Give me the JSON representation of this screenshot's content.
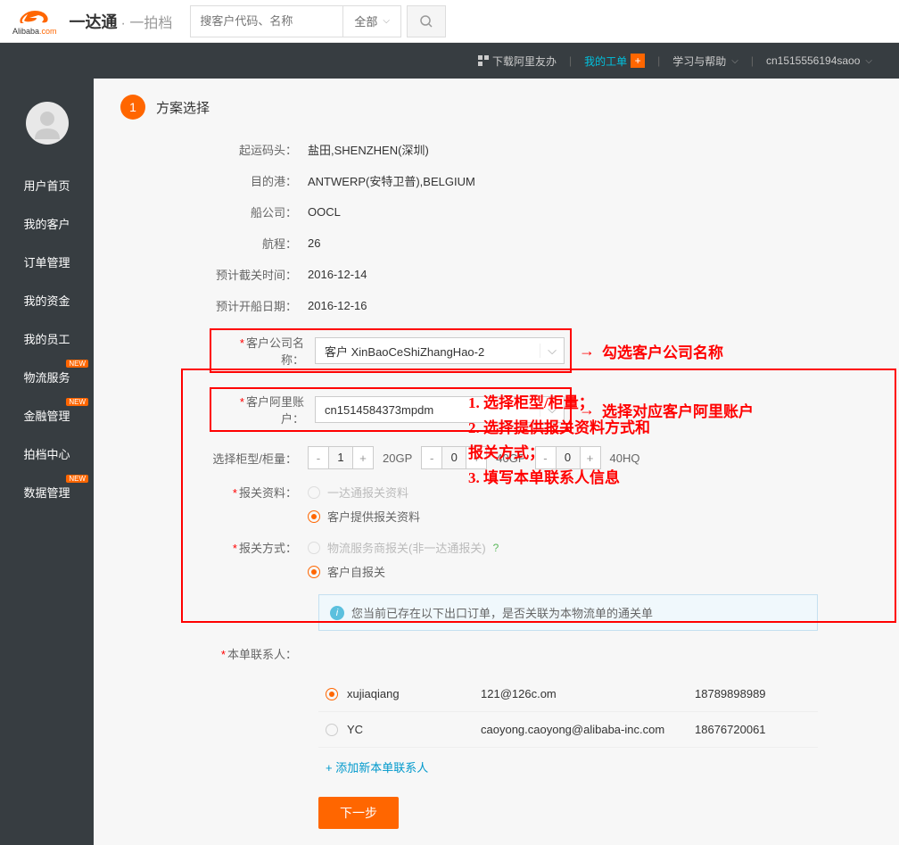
{
  "header": {
    "logo_text": "Alibaba",
    "logo_suffix": ".com",
    "brand": "一达通",
    "brand_sub": "· 一拍档",
    "search_placeholder": "搜客户代码、名称",
    "search_dropdown": "全部"
  },
  "navbar": {
    "download": "下载阿里友办",
    "workorder": "我的工单",
    "workorder_badge": "+",
    "help": "学习与帮助",
    "username": "cn1515556194saoo"
  },
  "sidebar": {
    "items": [
      {
        "label": "用户首页",
        "new": false
      },
      {
        "label": "我的客户",
        "new": false
      },
      {
        "label": "订单管理",
        "new": false
      },
      {
        "label": "我的资金",
        "new": false
      },
      {
        "label": "我的员工",
        "new": false
      },
      {
        "label": "物流服务",
        "new": true
      },
      {
        "label": "金融管理",
        "new": true
      },
      {
        "label": "拍档中心",
        "new": false
      },
      {
        "label": "数据管理",
        "new": true
      }
    ],
    "new_badge": "NEW"
  },
  "step": {
    "number": "1",
    "title": "方案选择"
  },
  "form": {
    "port_label": "起运码头：",
    "port_value": "盐田,SHENZHEN(深圳)",
    "dest_label": "目的港：",
    "dest_value": "ANTWERP(安特卫普),BELGIUM",
    "ship_label": "船公司：",
    "ship_value": "OOCL",
    "voyage_label": "航程：",
    "voyage_value": "26",
    "cutoff_label": "预计截关时间：",
    "cutoff_value": "2016-12-14",
    "departure_label": "预计开船日期：",
    "departure_value": "2016-12-16",
    "company_label": "客户公司名称：",
    "company_value": "客户 XinBaoCeShiZhangHao-2",
    "account_label": "客户阿里账户：",
    "account_value": "cn1514584373mpdm",
    "container_label": "选择柜型/柜量：",
    "container_types": [
      {
        "qty": "1",
        "unit": "20GP"
      },
      {
        "qty": "0",
        "unit": "40GP"
      },
      {
        "qty": "0",
        "unit": "40HQ"
      }
    ],
    "material_label": "报关资料：",
    "material_options": [
      {
        "label": "一达通报关资料",
        "checked": false,
        "disabled": true
      },
      {
        "label": "客户提供报关资料",
        "checked": true,
        "disabled": false
      }
    ],
    "method_label": "报关方式：",
    "method_options": [
      {
        "label": "物流服务商报关(非一达通报关)",
        "checked": false,
        "disabled": true,
        "help": true
      },
      {
        "label": "客户自报关",
        "checked": true,
        "disabled": false
      }
    ],
    "info_text": "您当前已存在以下出口订单，是否关联为本物流单的通关单",
    "contact_label": "本单联系人：",
    "contacts": [
      {
        "name": "xujiaqiang",
        "email": "121@126c.om",
        "phone": "18789898989",
        "checked": true
      },
      {
        "name": "YC",
        "email": "caoyong.caoyong@alibaba-inc.com",
        "phone": "18676720061",
        "checked": false
      }
    ],
    "add_contact": "+ 添加新本单联系人",
    "next_btn": "下一步"
  },
  "annotations": {
    "company_note": "勾选客户公司名称",
    "account_note": "选择对应客户阿里账户",
    "list": [
      "1. 选择柜型/柜量；",
      "2. 选择提供报关资料方式和",
      "报关方式；",
      "3. 填写本单联系人信息"
    ]
  }
}
